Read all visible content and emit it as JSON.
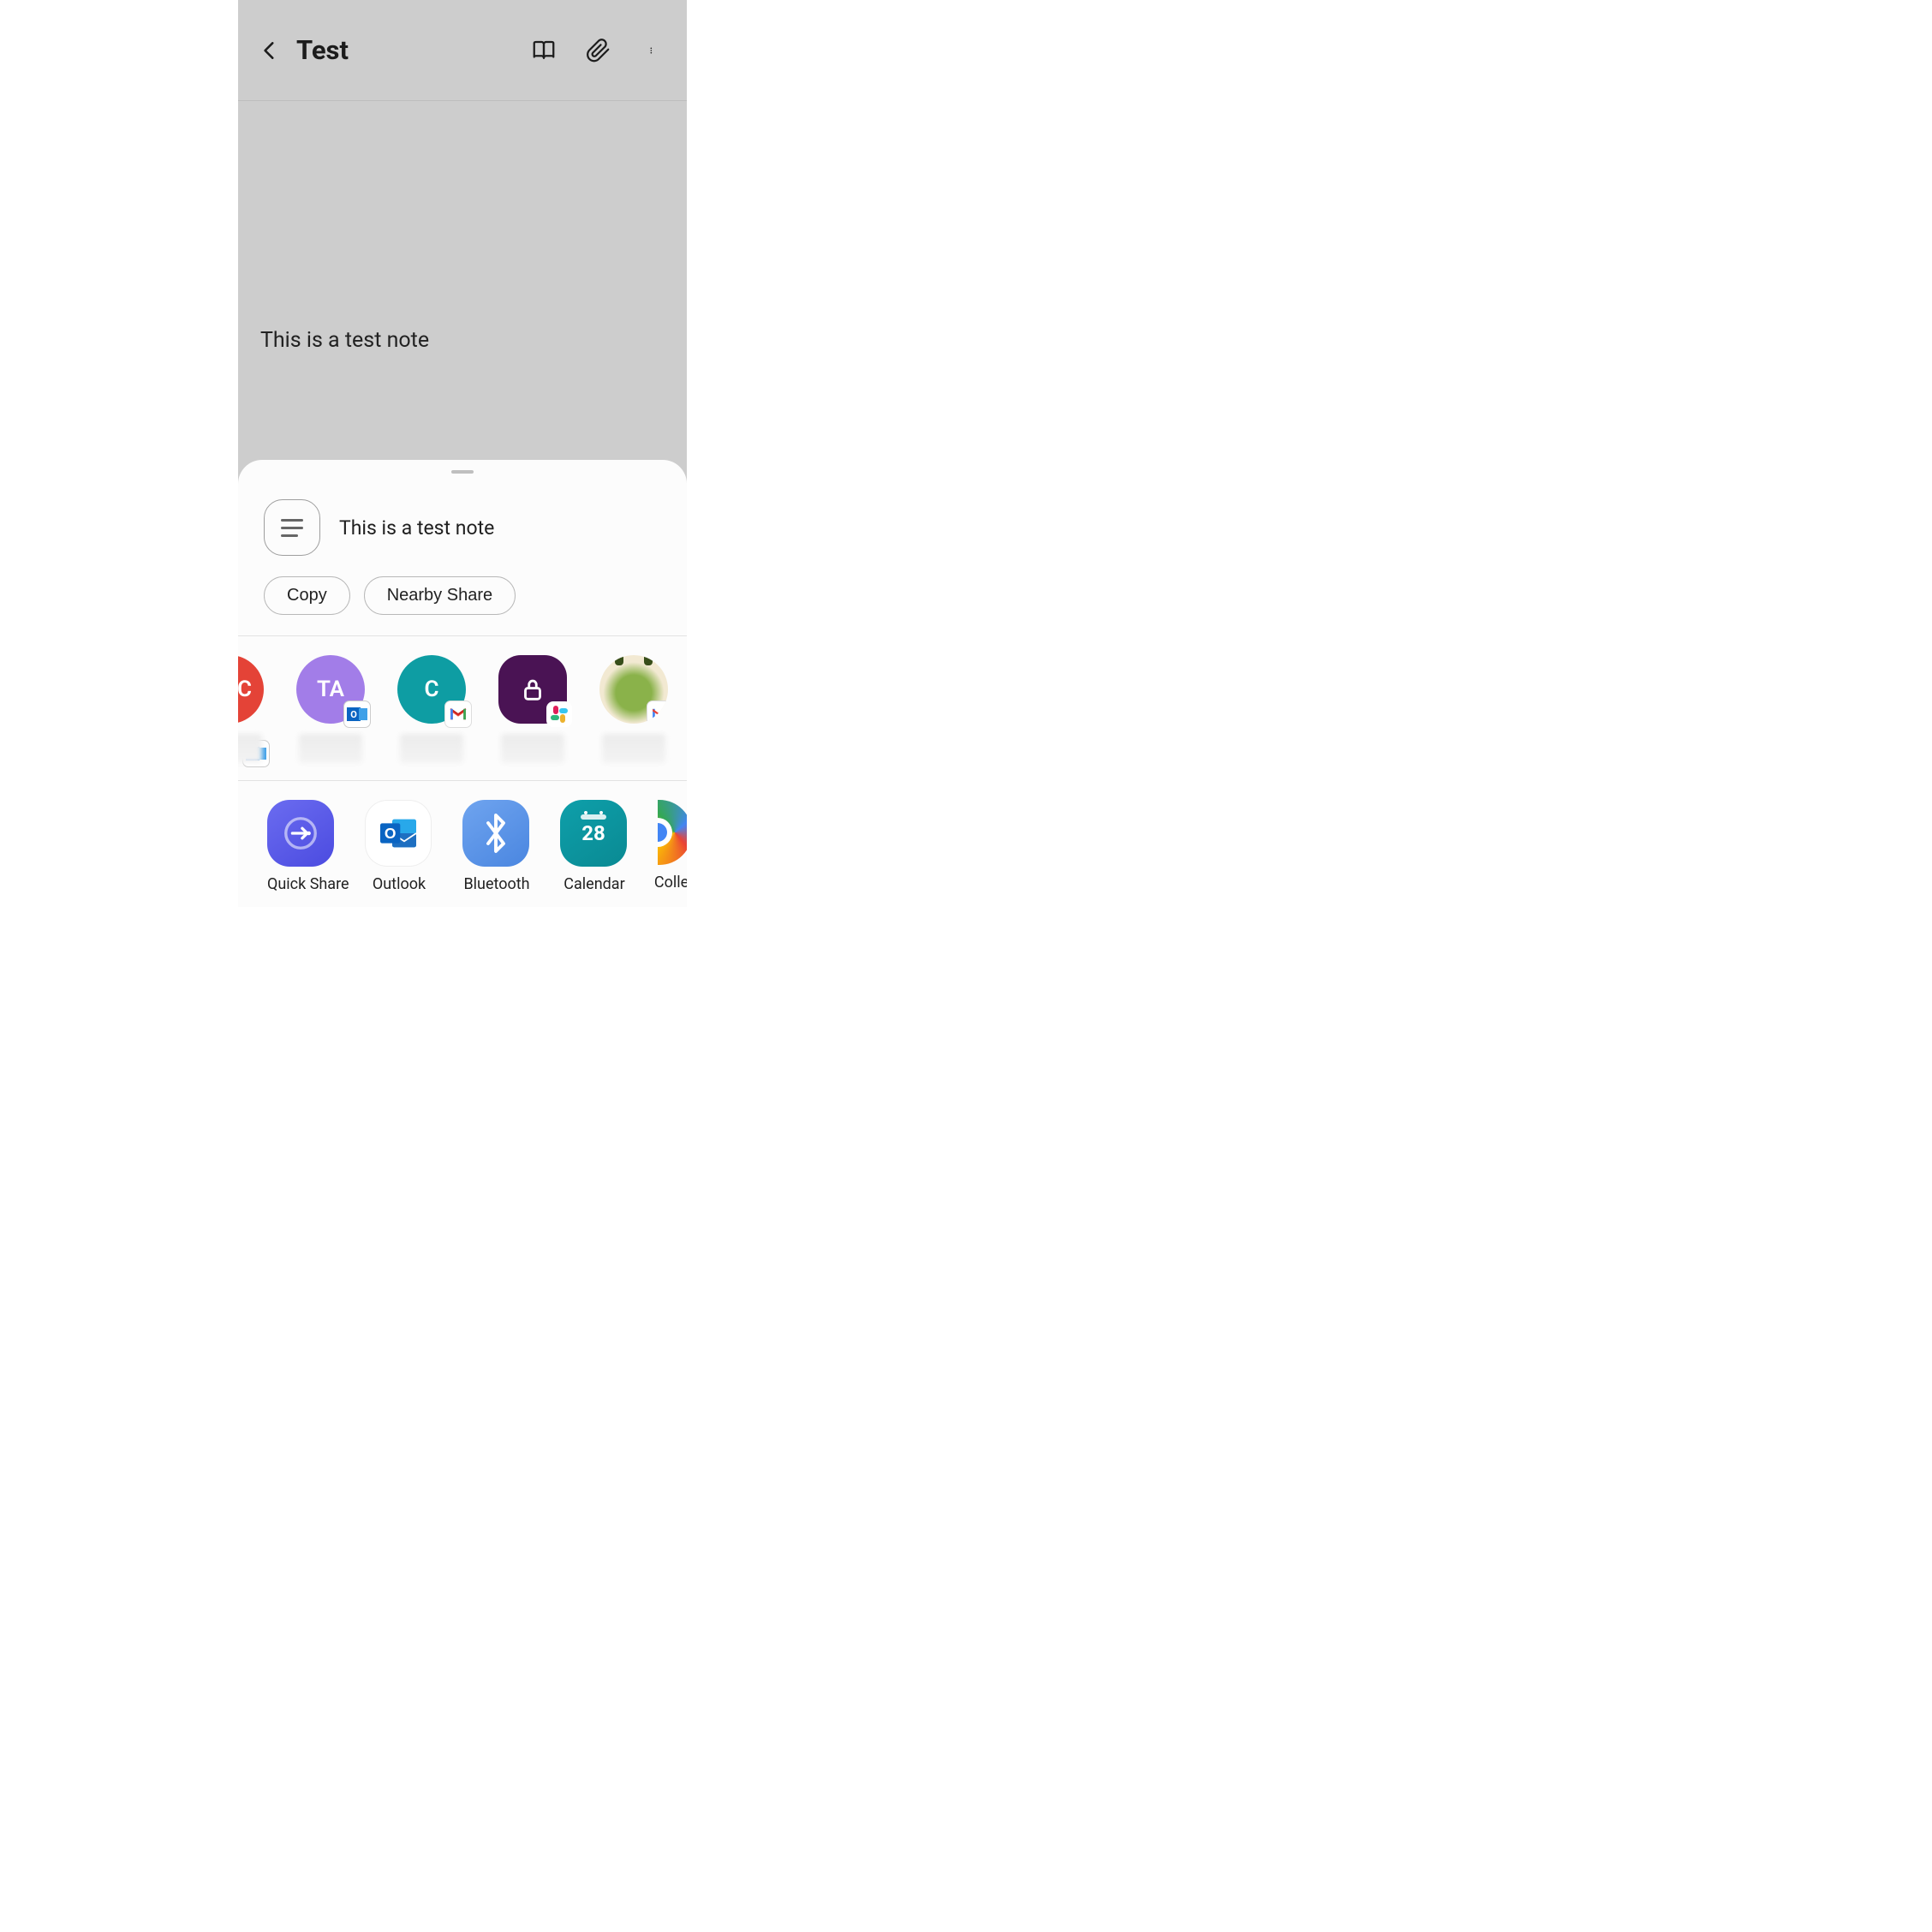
{
  "header": {
    "title": "Test"
  },
  "note": {
    "body": "This is a test note"
  },
  "share": {
    "content_preview": "This is a test note",
    "actions": {
      "copy": "Copy",
      "nearby": "Nearby Share"
    },
    "contacts": [
      {
        "initials": "C",
        "avatar_color": "#e44337",
        "badge": "outlook",
        "partial": true
      },
      {
        "initials": "TA",
        "avatar_color": "#a27de8",
        "badge": "outlook"
      },
      {
        "initials": "C",
        "avatar_color": "#0e9da3",
        "badge": "gmail"
      },
      {
        "initials": "",
        "avatar_color": "#4a1354",
        "badge": "slack",
        "icon": "lock"
      },
      {
        "initials": "",
        "avatar_color": "#f2e9d2",
        "badge": "gmail",
        "image": "dino"
      }
    ],
    "apps": [
      {
        "label": "Quick Share",
        "icon": "quick-share"
      },
      {
        "label": "Outlook",
        "icon": "outlook"
      },
      {
        "label": "Bluetooth",
        "icon": "bluetooth"
      },
      {
        "label": "Calendar",
        "icon": "calendar",
        "day": "28"
      },
      {
        "label": "Colle",
        "icon": "chrome",
        "partial": true
      }
    ]
  }
}
